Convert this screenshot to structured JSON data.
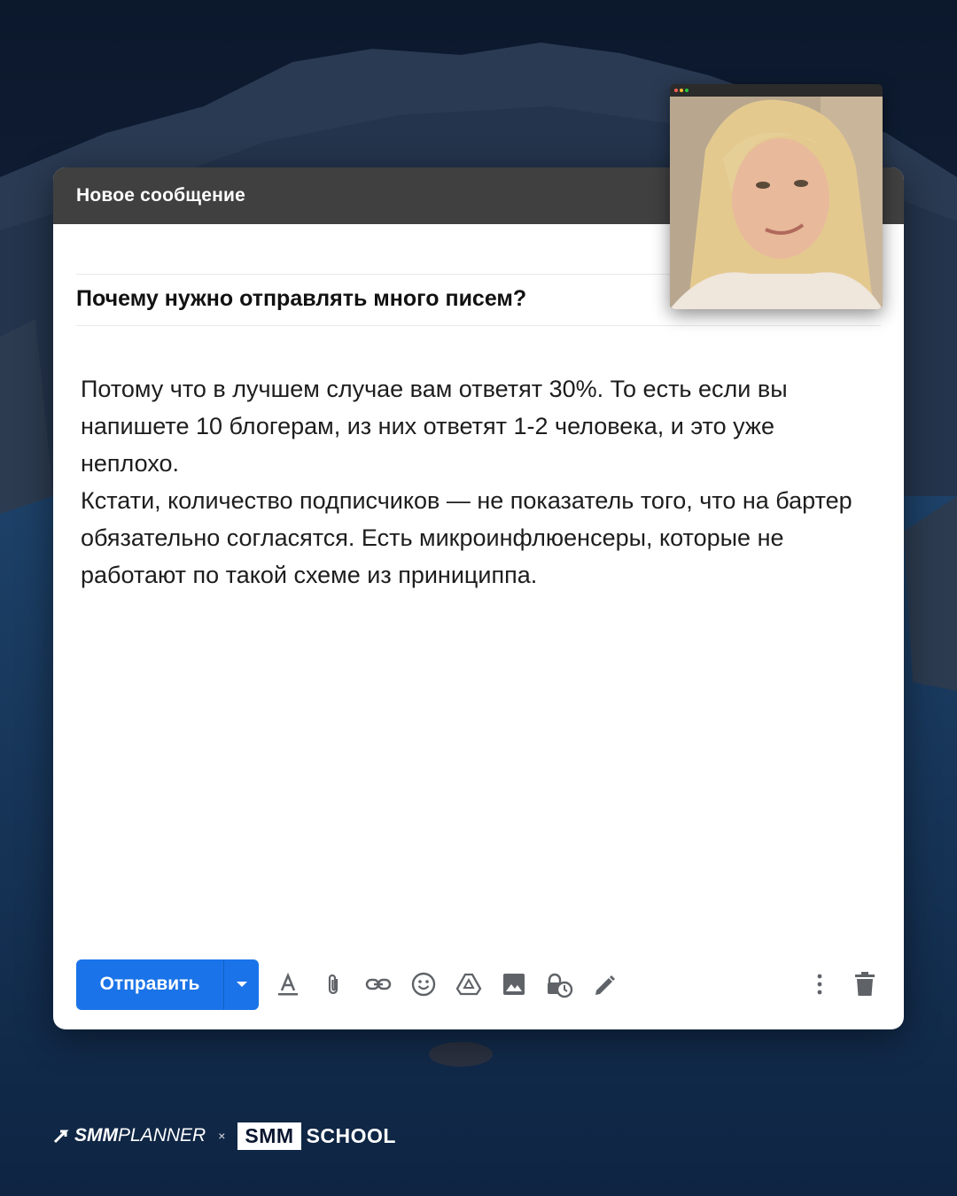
{
  "compose": {
    "title": "Новое сообщение",
    "subject": "Почему нужно отправлять много писем?",
    "body_paragraphs": [
      "Потому что в лучшем случае вам ответят 30%. То есть если вы напишете 10 блогерам, из них ответят 1-2 человека, и это уже неплохо.",
      "Кстати, количество подписчиков — не показатель того, что на бартер обязательно согласятся. Есть микроинфлюенсеры, которые не работают по такой схеме из принициппа."
    ]
  },
  "toolbar": {
    "send_label": "Отправить",
    "icons": [
      "format-text-icon",
      "attach-icon",
      "link-icon",
      "emoji-icon",
      "drive-icon",
      "image-icon",
      "confidential-mode-icon",
      "signature-icon",
      "more-options-icon",
      "trash-icon"
    ]
  },
  "footer": {
    "brand_bold": "SMM",
    "brand_light": "PLANNER",
    "separator": "×",
    "partner_box": "SMM",
    "partner_text": "SCHOOL"
  },
  "colors": {
    "header_bg": "#404040",
    "send_button": "#1a73e8",
    "icon_gray": "#5f6368"
  }
}
